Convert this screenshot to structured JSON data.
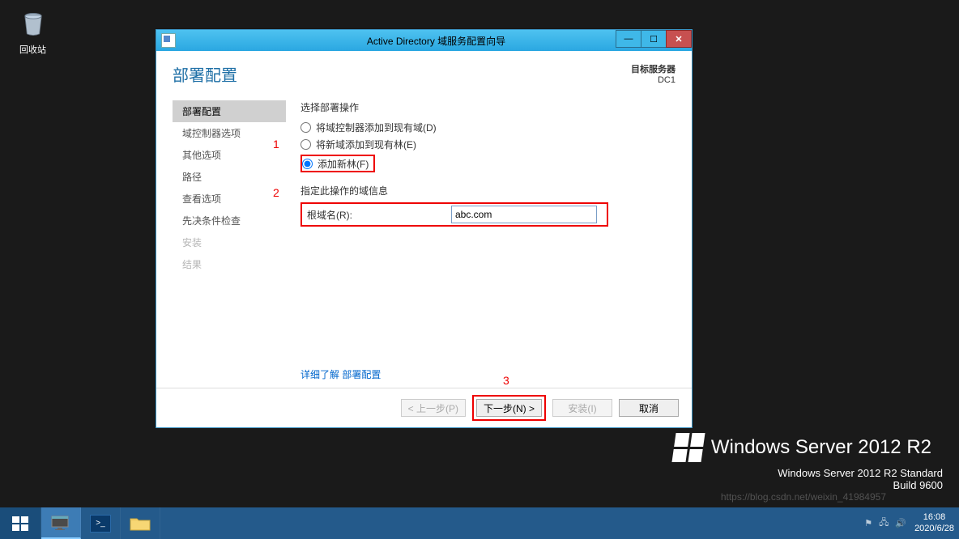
{
  "desktop": {
    "recycle_bin": "回收站"
  },
  "wizard": {
    "title": "Active Directory 域服务配置向导",
    "heading": "部署配置",
    "target_label": "目标服务器",
    "target_value": "DC1",
    "sidebar": {
      "items": [
        {
          "label": "部署配置",
          "state": "active"
        },
        {
          "label": "域控制器选项",
          "state": "normal"
        },
        {
          "label": "其他选项",
          "state": "normal"
        },
        {
          "label": "路径",
          "state": "normal"
        },
        {
          "label": "查看选项",
          "state": "normal"
        },
        {
          "label": "先决条件检查",
          "state": "normal"
        },
        {
          "label": "安装",
          "state": "disabled"
        },
        {
          "label": "结果",
          "state": "disabled"
        }
      ]
    },
    "main": {
      "select_op_label": "选择部署操作",
      "radio_add_dc": "将域控制器添加到现有域(D)",
      "radio_add_domain": "将新域添加到现有林(E)",
      "radio_new_forest": "添加新林(F)",
      "domain_info_label": "指定此操作的域信息",
      "root_domain_label": "根域名(R):",
      "root_domain_value": "abc.com",
      "learn_more_prefix": "详细了解",
      "learn_more_link": "部署配置"
    },
    "annotations": {
      "n1": "1",
      "n2": "2",
      "n3": "3"
    },
    "buttons": {
      "prev": "< 上一步(P)",
      "next": "下一步(N) >",
      "install": "安装(I)",
      "cancel": "取消"
    }
  },
  "branding": {
    "text": "Windows Server 2012 R2",
    "edition": "Windows Server 2012 R2 Standard",
    "build": "Build 9600"
  },
  "watermark": "https://blog.csdn.net/weixin_41984957",
  "taskbar": {
    "time": "16:08",
    "date": "2020/6/28"
  }
}
